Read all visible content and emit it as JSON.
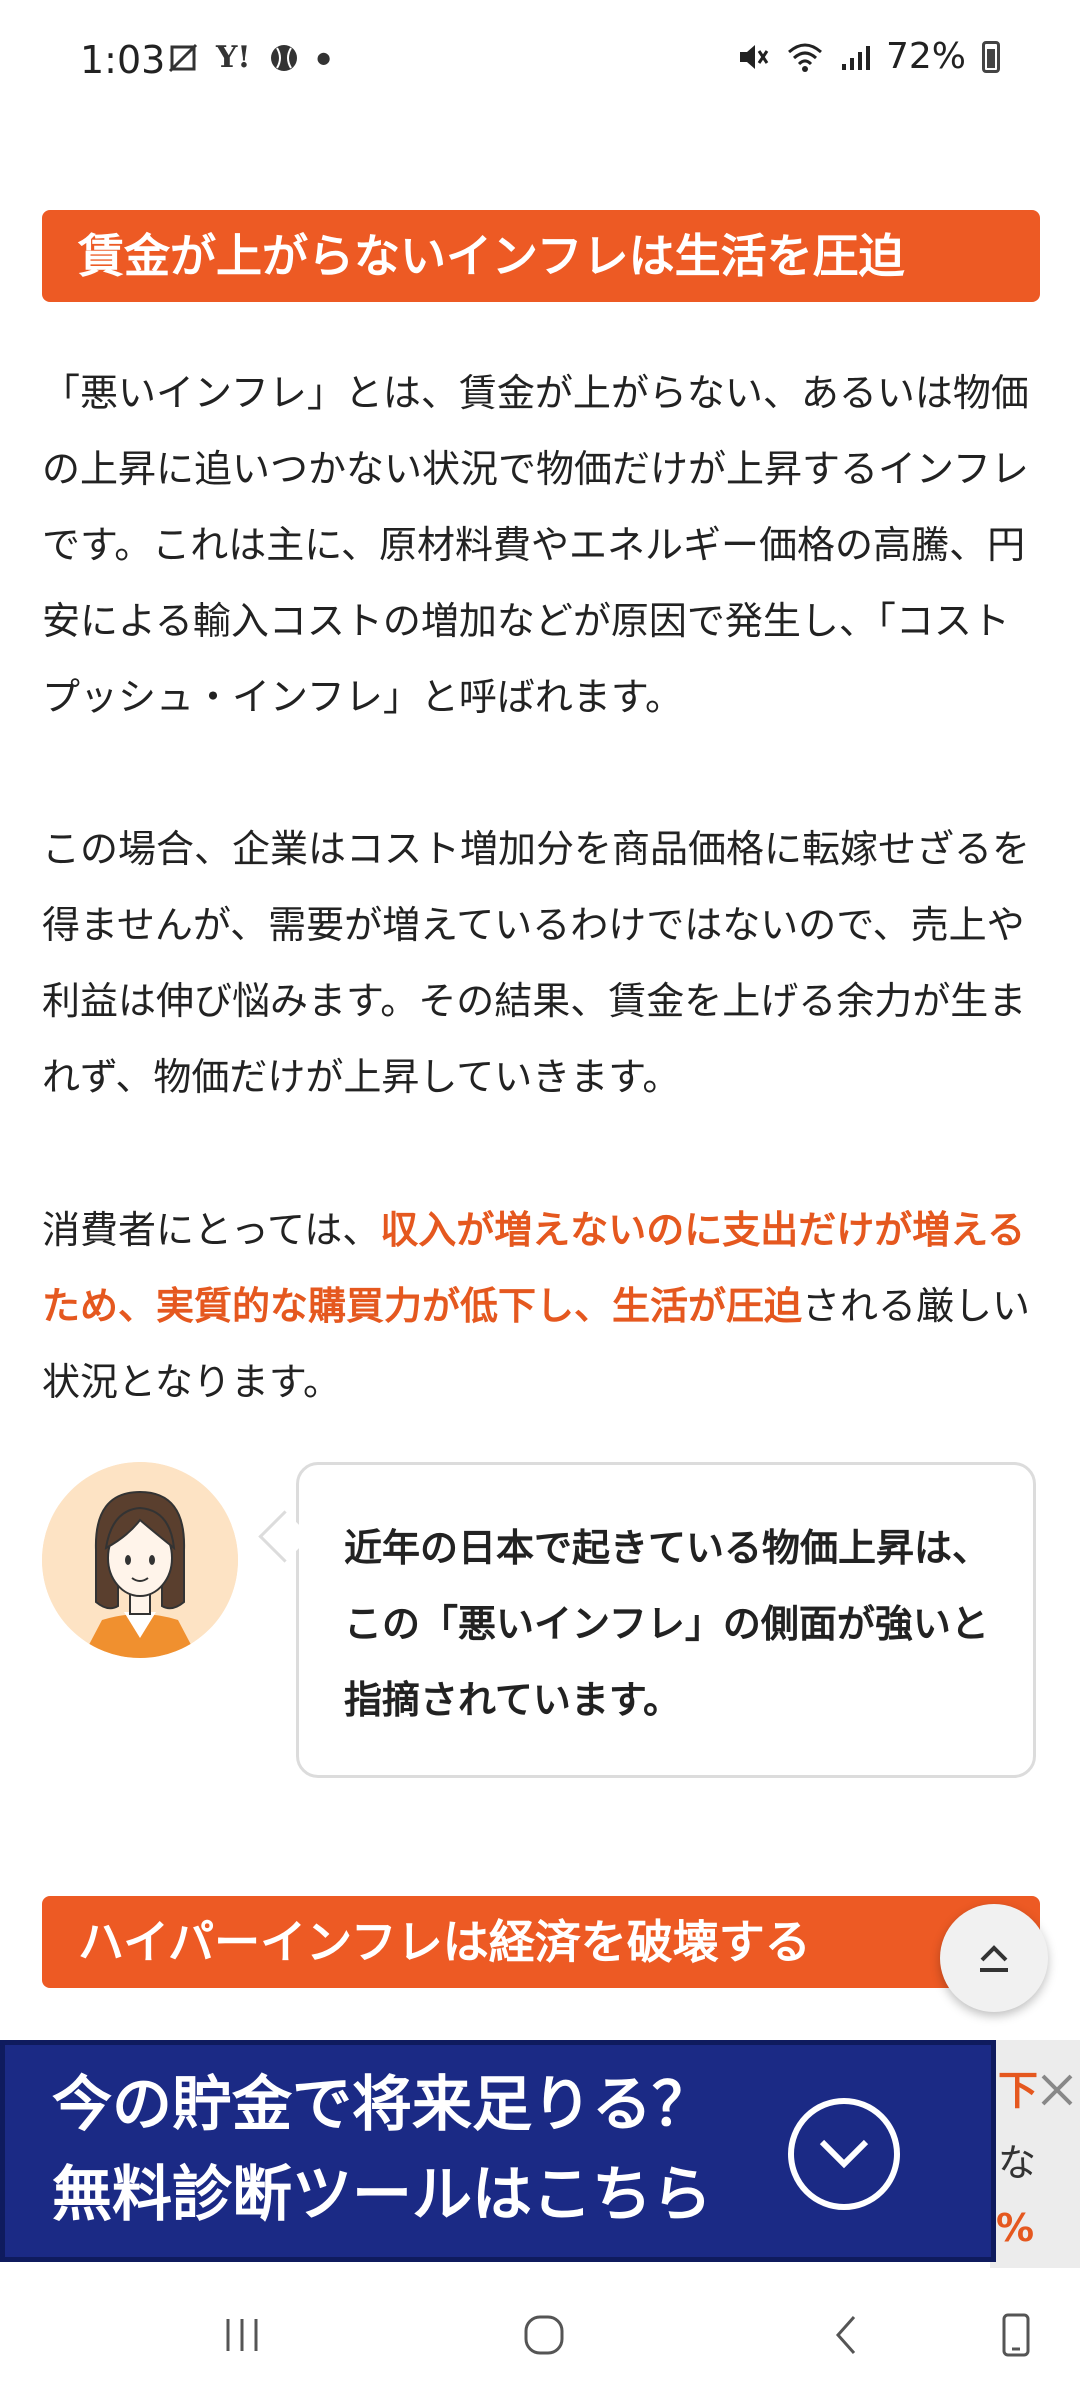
{
  "status_bar": {
    "time": "1:03",
    "left_icons": [
      "Y!",
      "●"
    ],
    "battery": "72%"
  },
  "article": {
    "heading1": "賃金が上がらないインフレは生活を圧迫",
    "paragraph1": "「悪いインフレ」とは、賃金が上がらない、あるいは物価の上昇に追いつかない状況で物価だけが上昇するインフレです。これは主に、原材料費やエネルギー価格の高騰、円安による輸入コストの増加などが原因で発生し、「コストプッシュ・インフレ」と呼ばれます。",
    "paragraph2": "この場合、企業はコスト増加分を商品価格に転嫁せざるを得ませんが、需要が増えているわけではないので、売上や利益は伸び悩みます。その結果、賃金を上げる余力が生まれず、物価だけが上昇していきます。",
    "paragraph3_prefix": "消費者にとっては、",
    "paragraph3_emphasis": "収入が増えないのに支出だけが増えるため、実質的な購買力が低下し、生活が圧迫",
    "paragraph3_suffix": "される厳しい状況となります。",
    "bubble_text": "近年の日本で起きている物価上昇は、この「悪いインフレ」の側面が強いと指摘されています。",
    "heading2": "ハイパーインフレは経済を破壊する"
  },
  "ad": {
    "line1": "今の貯金で将来足りる？",
    "line2": "無料診断ツールはこちら",
    "partial_right": [
      "下",
      "な",
      "%"
    ]
  },
  "colors": {
    "accent": "#ed5a24",
    "emphasis_text": "#e5581f",
    "ad_background": "#1b2a85"
  }
}
